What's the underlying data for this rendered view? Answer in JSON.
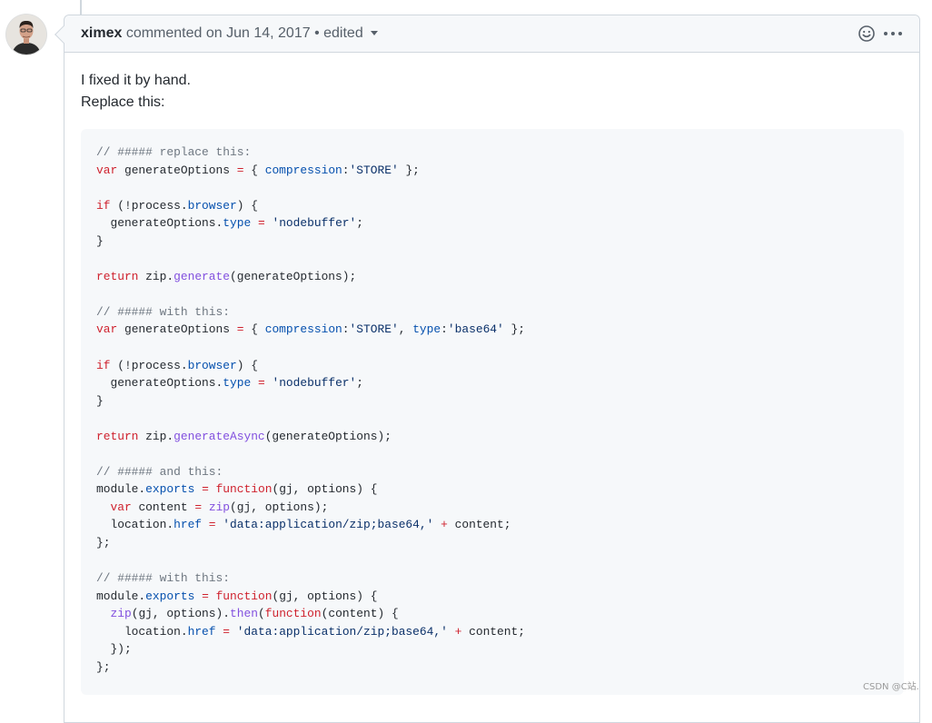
{
  "comment": {
    "author": "ximex",
    "action_text": " commented on Jun 14, 2017",
    "separator": " • ",
    "edited_label": "edited",
    "body_lines": [
      "I fixed it by hand.",
      "Replace this:"
    ],
    "code_language": "javascript",
    "code": "// ##### replace this:\nvar generateOptions = { compression:'STORE' };\n\nif (!process.browser) {\n  generateOptions.type = 'nodebuffer';\n}\n\nreturn zip.generate(generateOptions);\n\n// ##### with this:\nvar generateOptions = { compression:'STORE', type:'base64' };\n\nif (!process.browser) {\n  generateOptions.type = 'nodebuffer';\n}\n\nreturn zip.generateAsync(generateOptions);\n\n// ##### and this:\nmodule.exports = function(gj, options) {\n  var content = zip(gj, options);\n  location.href = 'data:application/zip;base64,' + content;\n};\n\n// ##### with this:\nmodule.exports = function(gj, options) {\n  zip(gj, options).then(function(content) {\n    location.href = 'data:application/zip;base64,' + content;\n  });\n};"
  },
  "header_icons": {
    "reaction": "smiley-icon",
    "more": "kebab-horizontal-icon"
  },
  "watermark": "CSDN @C站.",
  "colors": {
    "comment_gray": "#6e7781",
    "keyword_red": "#cf222e",
    "string_blue": "#0a3069",
    "property_blue": "#0550ae",
    "function_purple": "#8250df",
    "border": "#d0d7de",
    "header_bg": "#f6f8fa"
  }
}
